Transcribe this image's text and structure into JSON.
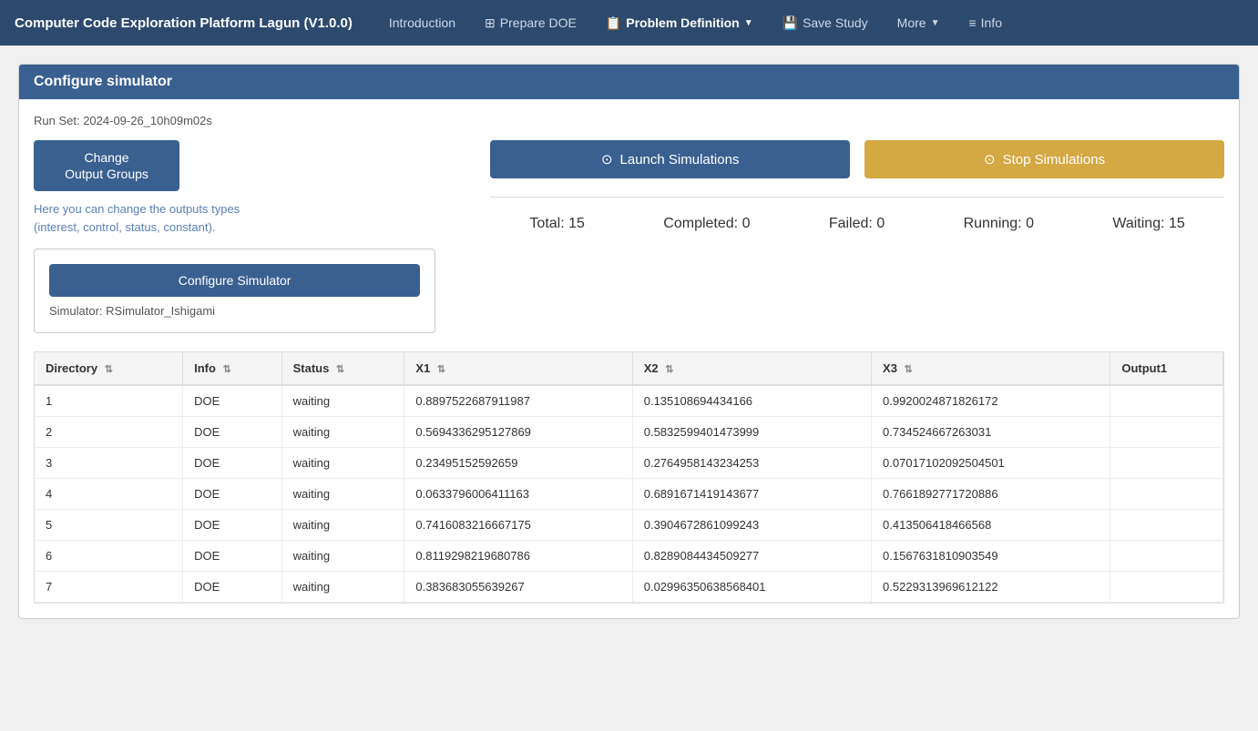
{
  "app": {
    "title": "Computer Code Exploration Platform Lagun (V1.0.0)"
  },
  "navbar": {
    "brand": "Computer Code Exploration Platform Lagun (V1.0.0)",
    "links": [
      {
        "id": "introduction",
        "label": "Introduction",
        "icon": "",
        "active": false
      },
      {
        "id": "prepare-doe",
        "label": "Prepare DOE",
        "icon": "⊞",
        "active": false
      },
      {
        "id": "problem-definition",
        "label": "Problem Definition",
        "icon": "📋",
        "active": true,
        "dropdown": true
      },
      {
        "id": "save-study",
        "label": "Save Study",
        "icon": "💾",
        "active": false
      },
      {
        "id": "more",
        "label": "More",
        "icon": "",
        "active": false,
        "dropdown": true
      },
      {
        "id": "info",
        "label": "Info",
        "icon": "≡",
        "active": false
      }
    ]
  },
  "panel": {
    "title": "Configure simulator",
    "run_set_label": "Run Set: 2024-09-26_10h09m02s",
    "change_output_btn": "Change\nOutput Groups",
    "change_output_line1": "Change",
    "change_output_line2": "Output Groups",
    "output_hint": "Here you can change the outputs types\n(interest, control, status, constant).",
    "configure_btn": "Configure Simulator",
    "simulator_label": "Simulator: RSimulator_Ishigami"
  },
  "simulation": {
    "launch_btn": "Launch Simulations",
    "stop_btn": "Stop Simulations",
    "total_label": "Total:",
    "total_value": "15",
    "completed_label": "Completed:",
    "completed_value": "0",
    "failed_label": "Failed:",
    "failed_value": "0",
    "running_label": "Running:",
    "running_value": "0",
    "waiting_label": "Waiting:",
    "waiting_value": "15"
  },
  "table": {
    "columns": [
      {
        "id": "directory",
        "label": "Directory"
      },
      {
        "id": "info",
        "label": "Info"
      },
      {
        "id": "status",
        "label": "Status"
      },
      {
        "id": "x1",
        "label": "X1"
      },
      {
        "id": "x2",
        "label": "X2"
      },
      {
        "id": "x3",
        "label": "X3"
      },
      {
        "id": "output1",
        "label": "Output1"
      }
    ],
    "rows": [
      {
        "directory": "1",
        "info": "DOE",
        "status": "waiting",
        "x1": "0.8897522687911987",
        "x2": "0.135108694434166",
        "x3": "0.9920024871826172",
        "output1": ""
      },
      {
        "directory": "2",
        "info": "DOE",
        "status": "waiting",
        "x1": "0.5694336295127869",
        "x2": "0.5832599401473999",
        "x3": "0.734524667263031",
        "output1": ""
      },
      {
        "directory": "3",
        "info": "DOE",
        "status": "waiting",
        "x1": "0.23495152592659",
        "x2": "0.2764958143234253",
        "x3": "0.07017102092504501",
        "output1": ""
      },
      {
        "directory": "4",
        "info": "DOE",
        "status": "waiting",
        "x1": "0.0633796006411163",
        "x2": "0.6891671419143677",
        "x3": "0.7661892771720886",
        "output1": ""
      },
      {
        "directory": "5",
        "info": "DOE",
        "status": "waiting",
        "x1": "0.7416083216667175",
        "x2": "0.3904672861099243",
        "x3": "0.413506418466568",
        "output1": ""
      },
      {
        "directory": "6",
        "info": "DOE",
        "status": "waiting",
        "x1": "0.8119298219680786",
        "x2": "0.8289084434509277",
        "x3": "0.1567631810903549",
        "output1": ""
      },
      {
        "directory": "7",
        "info": "DOE",
        "status": "waiting",
        "x1": "0.383683055639267",
        "x2": "0.02996350638568401",
        "x3": "0.5229313969612122",
        "output1": ""
      }
    ]
  },
  "colors": {
    "navbar_bg": "#2c4a6e",
    "panel_header": "#3a6090",
    "btn_primary": "#3a6090",
    "btn_stop": "#d4a843",
    "link_color": "#3a6090",
    "waiting_color": "#3a6090"
  }
}
